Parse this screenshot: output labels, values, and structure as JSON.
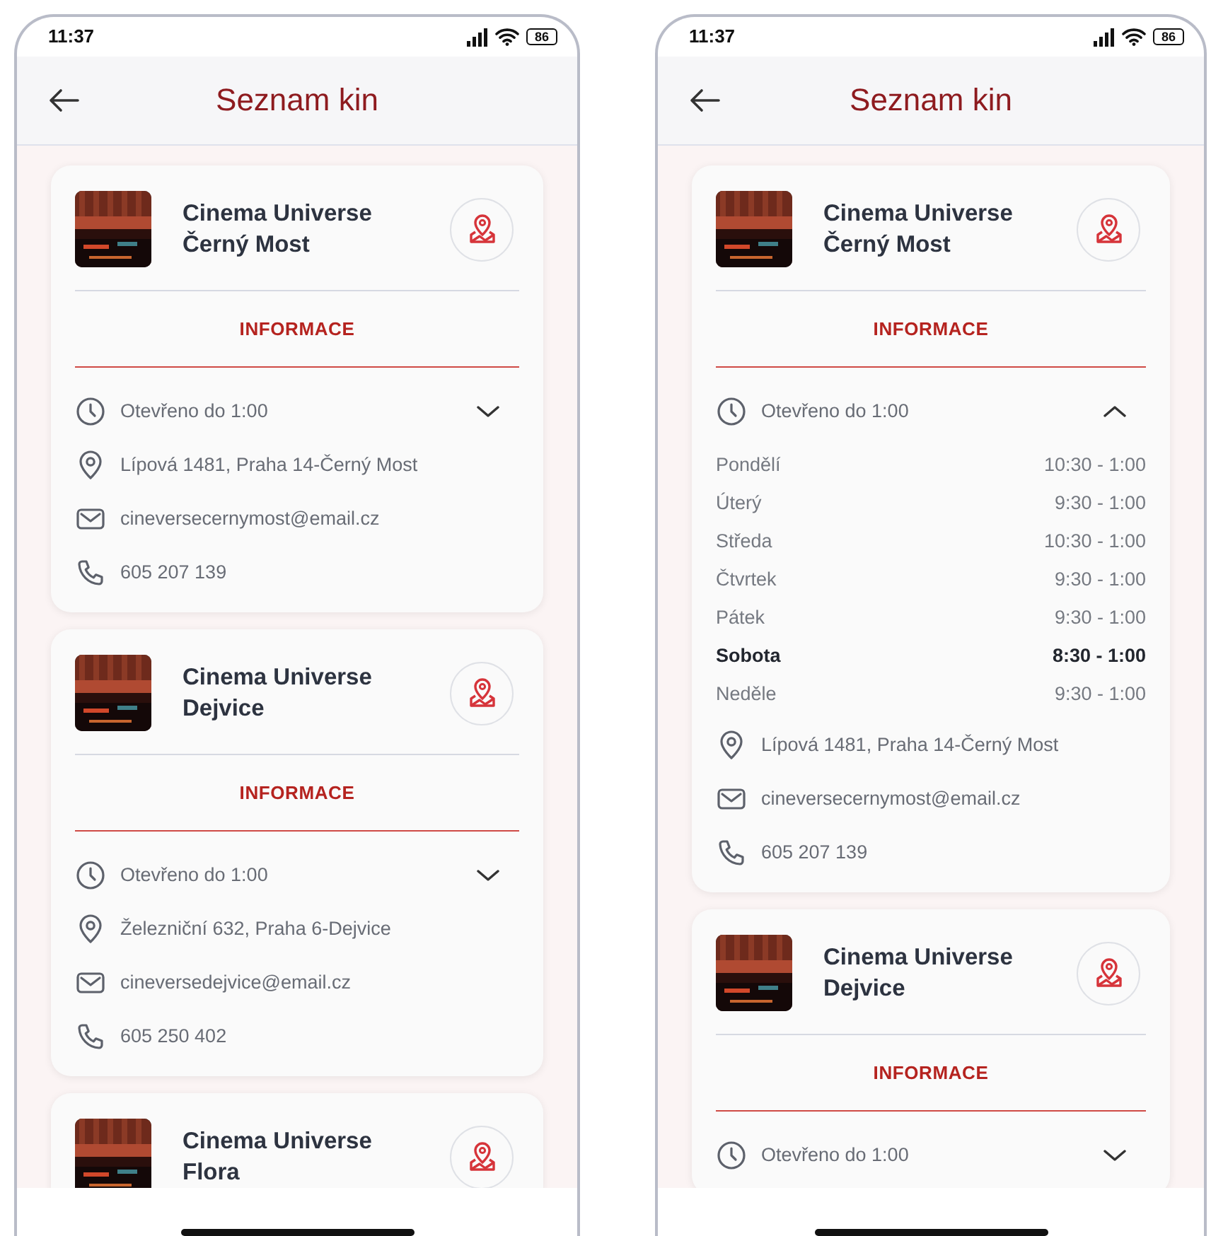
{
  "phones": [
    {
      "status": {
        "time": "11:37",
        "battery": "86"
      },
      "header": {
        "title": "Seznam kin"
      },
      "cinemas": [
        {
          "name_lines": [
            "Cinema Universe",
            "Černý Most"
          ],
          "tab": "INFORMACE",
          "hours_summary": "Otevřeno do 1:00",
          "expanded": false,
          "address": "Lípová 1481, Praha 14-Černý Most",
          "email": "cineversecernymost@email.cz",
          "phone": "605 207 139"
        },
        {
          "name_lines": [
            "Cinema Universe",
            "Dejvice"
          ],
          "tab": "INFORMACE",
          "hours_summary": "Otevřeno do 1:00",
          "expanded": false,
          "address": "Železniční 632, Praha 6-Dejvice",
          "email": "cineversedejvice@email.cz",
          "phone": "605 250 402"
        },
        {
          "name_lines": [
            "Cinema Universe",
            "Flora"
          ]
        }
      ]
    },
    {
      "status": {
        "time": "11:37",
        "battery": "86"
      },
      "header": {
        "title": "Seznam kin"
      },
      "cinemas": [
        {
          "name_lines": [
            "Cinema Universe",
            "Černý Most"
          ],
          "tab": "INFORMACE",
          "hours_summary": "Otevřeno do 1:00",
          "expanded": true,
          "schedule": [
            {
              "day": "Pondělí",
              "hours": "10:30 - 1:00",
              "today": false
            },
            {
              "day": "Úterý",
              "hours": "9:30 - 1:00",
              "today": false
            },
            {
              "day": "Středa",
              "hours": "10:30 - 1:00",
              "today": false
            },
            {
              "day": "Čtvrtek",
              "hours": "9:30 - 1:00",
              "today": false
            },
            {
              "day": "Pátek",
              "hours": "9:30 - 1:00",
              "today": false
            },
            {
              "day": "Sobota",
              "hours": "8:30 - 1:00",
              "today": true
            },
            {
              "day": "Neděle",
              "hours": "9:30 - 1:00",
              "today": false
            }
          ],
          "address": "Lípová 1481, Praha 14-Černý Most",
          "email": "cineversecernymost@email.cz",
          "phone": "605 207 139"
        },
        {
          "name_lines": [
            "Cinema Universe",
            "Dejvice"
          ],
          "tab": "INFORMACE",
          "hours_summary": "Otevřeno do 1:00",
          "expanded": false
        }
      ]
    }
  ]
}
